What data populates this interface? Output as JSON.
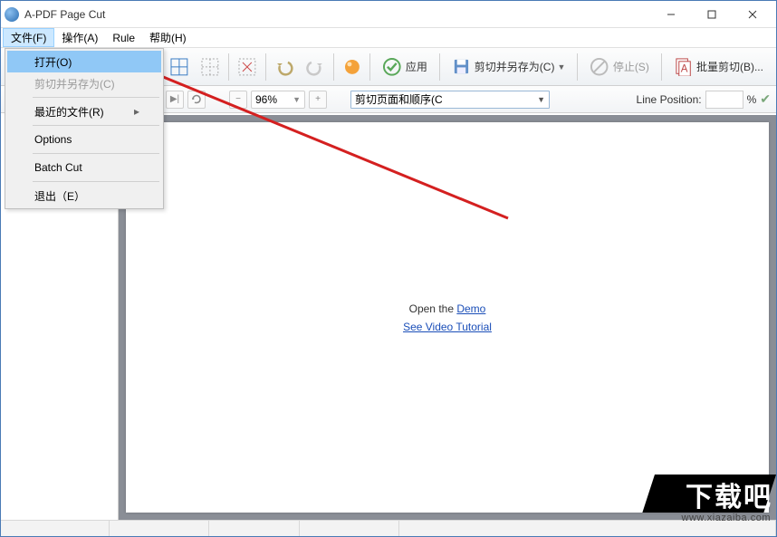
{
  "window": {
    "title": "A-PDF Page Cut"
  },
  "menubar": [
    {
      "label": "文件(F)"
    },
    {
      "label": "操作(A)"
    },
    {
      "label": "Rule"
    },
    {
      "label": "帮助(H)"
    }
  ],
  "file_menu": {
    "open": "打开(O)",
    "cut_save_as": "剪切并另存为(C)",
    "recent": "最近的文件(R)",
    "options": "Options",
    "batch_cut": "Batch Cut",
    "exit": "退出（E）"
  },
  "toolbar": {
    "apply": "应用",
    "cut_save": "剪切并另存为(C)",
    "stop": "停止(S)",
    "batch": "批量剪切(B)..."
  },
  "toolbar2": {
    "zoom": "96%",
    "combo": "剪切页面和顺序(C",
    "lp_label": "Line Position:",
    "lp_value": "",
    "pct": "%"
  },
  "canvas": {
    "open_prefix": "Open the ",
    "demo": "Demo",
    "tutorial": "See Video Tutorial "
  },
  "watermark": {
    "big": "下载吧",
    "url": "www.xiazaiba.com"
  }
}
